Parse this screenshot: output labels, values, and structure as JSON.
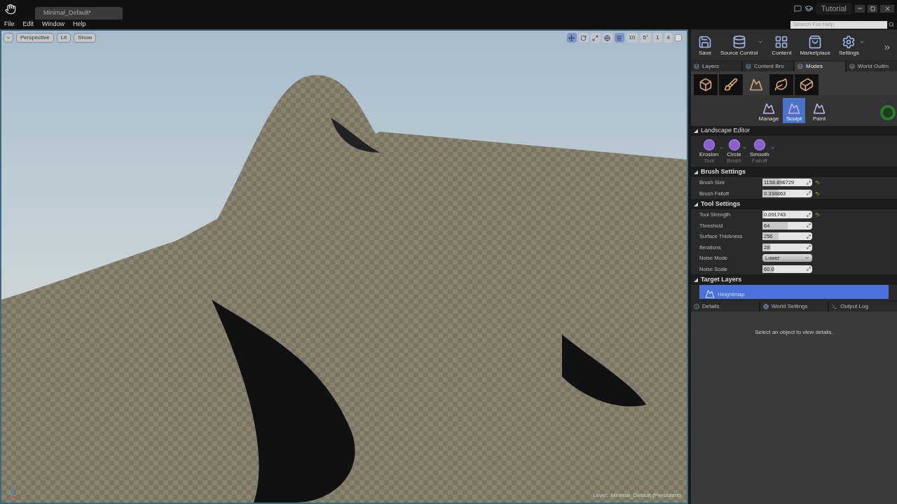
{
  "title_bar": {
    "document_tab": "Minimal_Default*",
    "tutorial": "Tutorial",
    "search": {
      "placeholder": "Search For Help"
    }
  },
  "menu": [
    "File",
    "Edit",
    "Window",
    "Help"
  ],
  "viewport": {
    "view_buttons": [
      "Perspective",
      "Lit",
      "Show"
    ],
    "snap_values": [
      "10",
      "5°",
      "1",
      "4"
    ],
    "level_label": "Level:",
    "level_name": "Minimal_Default (Persistent)"
  },
  "toolbar": [
    {
      "label": "Save",
      "kind": "save",
      "dropdown": false
    },
    {
      "label": "Source Control",
      "kind": "source",
      "dropdown": true
    },
    {
      "label": "Content",
      "kind": "content",
      "dropdown": false
    },
    {
      "label": "Marketplace",
      "kind": "market",
      "dropdown": false
    },
    {
      "label": "Settings",
      "kind": "settings",
      "dropdown": true
    }
  ],
  "panel_tabs": [
    {
      "label": "Layers",
      "selected": false
    },
    {
      "label": "Content Bro",
      "selected": false
    },
    {
      "label": "Modes",
      "selected": true
    },
    {
      "label": "World Outlin",
      "selected": false
    }
  ],
  "mode_icons": [
    {
      "kind": "place",
      "selected": false
    },
    {
      "kind": "paint",
      "selected": false
    },
    {
      "kind": "landscape",
      "selected": true
    },
    {
      "kind": "foliage",
      "selected": false
    },
    {
      "kind": "geometry",
      "selected": false
    }
  ],
  "landscape_modes": [
    {
      "label": "Manage",
      "selected": false
    },
    {
      "label": "Sculpt",
      "selected": true
    },
    {
      "label": "Paint",
      "selected": false
    }
  ],
  "landscape_editor": {
    "title": "Landscape Editor",
    "tools": [
      {
        "label": "Erosion",
        "sub": "Tool"
      },
      {
        "label": "Circle",
        "sub": "Brush"
      },
      {
        "label": "Smooth",
        "sub": "Falloff"
      }
    ]
  },
  "sections": [
    {
      "title": "Brush Settings",
      "properties": [
        {
          "label": "Brush Size",
          "kind": "slider",
          "value": "1158.896729",
          "level": 0.36,
          "reset": true
        },
        {
          "label": "Brush Falloff",
          "kind": "slider",
          "value": "0.334863",
          "level": 0.33,
          "reset": true
        }
      ]
    },
    {
      "title": "Tool Settings",
      "properties": [
        {
          "label": "Tool Strength",
          "kind": "slider",
          "value": "0.091743",
          "level": 0.03,
          "reset": true
        },
        {
          "label": "Threshold",
          "kind": "slider",
          "value": "64",
          "level": 0.5,
          "reset": false
        },
        {
          "label": "Surface Thickness",
          "kind": "slider",
          "value": "256",
          "level": 0.33,
          "reset": false
        },
        {
          "label": "Iterations",
          "kind": "slider",
          "value": "28",
          "level": 0.17,
          "reset": false
        },
        {
          "label": "Noise Mode",
          "kind": "dropdown",
          "value": "Lower",
          "reset": false
        },
        {
          "label": "Noise Scale",
          "kind": "slider",
          "value": "60.0",
          "level": 0.23,
          "reset": false
        }
      ]
    }
  ],
  "target_layers": {
    "title": "Target Layers",
    "layers": [
      {
        "label": "Heightmap",
        "selected": true
      }
    ]
  },
  "details_tabs": [
    {
      "label": "Details",
      "kind": "details"
    },
    {
      "label": "World Settings",
      "kind": "world"
    },
    {
      "label": "Output Log",
      "kind": "log"
    }
  ],
  "details_message": "Select an object to view details."
}
